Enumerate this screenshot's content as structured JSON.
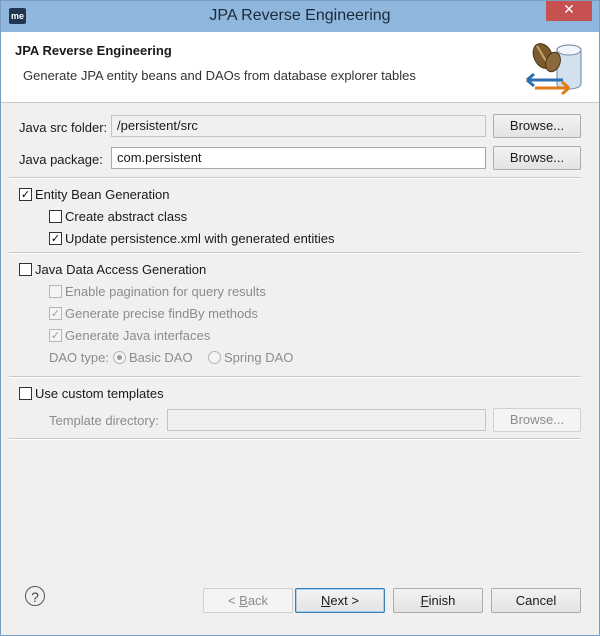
{
  "window": {
    "icon_text": "me",
    "title": "JPA Reverse Engineering",
    "close_glyph": "✕"
  },
  "header": {
    "title": "JPA Reverse Engineering",
    "description": "Generate JPA entity beans and DAOs from database explorer tables",
    "art_icon": "beans-database-icon"
  },
  "form": {
    "src_folder": {
      "label": "Java src folder:",
      "value": "/persistent/src",
      "browse": "Browse..."
    },
    "package": {
      "label": "Java package:",
      "value": "com.persistent",
      "browse": "Browse..."
    }
  },
  "entity": {
    "label": "Entity Bean Generation",
    "checked": true,
    "abstract_class": {
      "label": "Create abstract class",
      "checked": false
    },
    "update_persistence": {
      "label": "Update persistence.xml with generated entities",
      "checked": true
    }
  },
  "dao": {
    "label": "Java Data Access Generation",
    "checked": false,
    "pagination": {
      "label": "Enable pagination for query results",
      "checked": false
    },
    "precise_findby": {
      "label": "Generate precise findBy methods",
      "checked": true
    },
    "interfaces": {
      "label": "Generate Java interfaces",
      "checked": true
    },
    "type_label": "DAO type:",
    "basic_dao": "Basic DAO",
    "spring_dao": "Spring DAO",
    "selected": "Basic DAO"
  },
  "templates": {
    "label": "Use custom templates",
    "checked": false,
    "dir_label": "Template directory:",
    "dir_value": "",
    "browse": "Browse..."
  },
  "footer": {
    "help": "?",
    "back": {
      "mnemonic": "B",
      "rest": "ack",
      "prefix": "< "
    },
    "next": {
      "mnemonic": "N",
      "rest": "ext",
      "suffix": " >"
    },
    "finish": {
      "mnemonic": "F",
      "rest": "inish"
    },
    "cancel": "Cancel"
  }
}
